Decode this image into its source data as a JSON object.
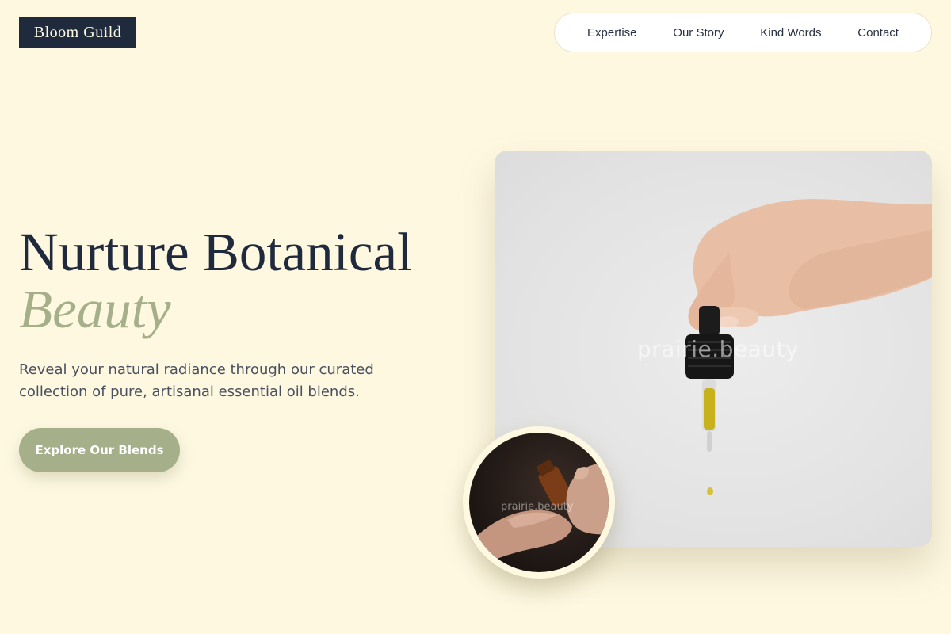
{
  "brand": {
    "name": "Bloom Guild"
  },
  "nav": {
    "items": [
      {
        "label": "Expertise"
      },
      {
        "label": "Our Story"
      },
      {
        "label": "Kind Words"
      },
      {
        "label": "Contact"
      }
    ]
  },
  "hero": {
    "title_line1": "Nurture Botanical",
    "title_line2": "Beauty",
    "subtitle": "Reveal your natural radiance through our curated collection of pure, artisanal essential oil blends.",
    "cta_label": "Explore Our Blends"
  },
  "images": {
    "main_watermark": "prairie.beauty",
    "inset_watermark": "prairie.beauty"
  },
  "colors": {
    "background": "#fef8e1",
    "navy": "#1f2a3d",
    "sage": "#a5b08b"
  }
}
